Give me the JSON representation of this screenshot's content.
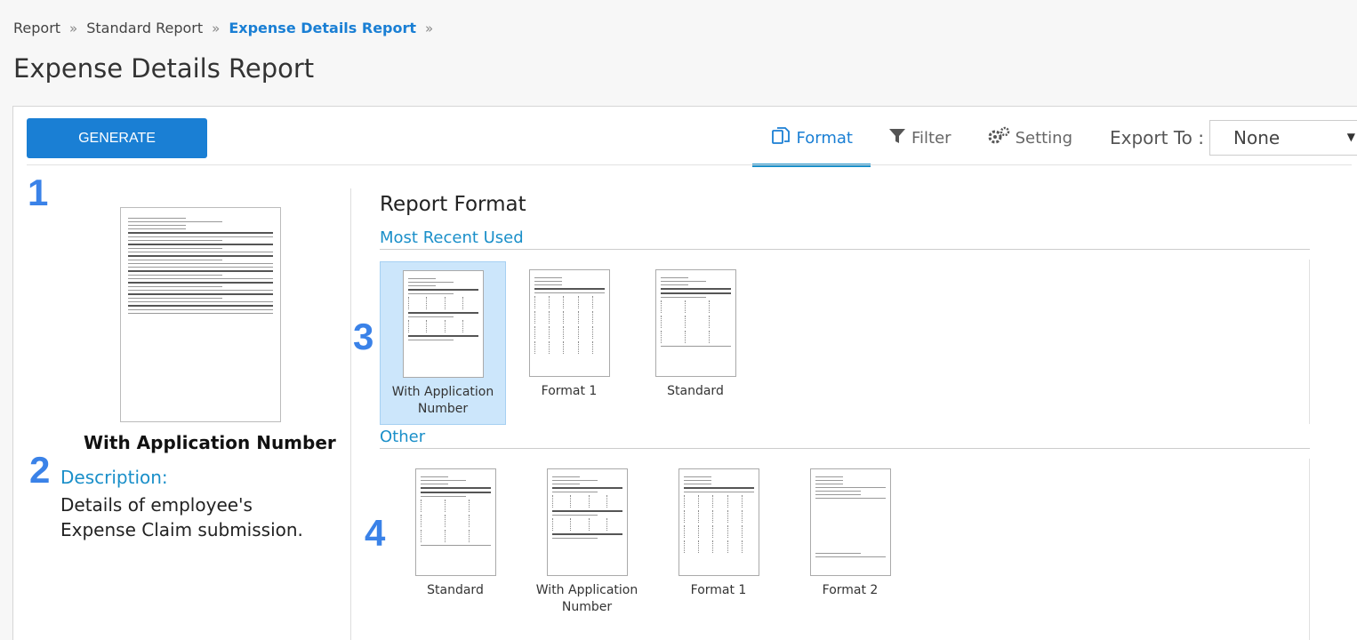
{
  "breadcrumb": [
    "Report",
    "Standard Report",
    "Expense Details Report"
  ],
  "page_title": "Expense Details Report",
  "toolbar": {
    "generate_label": "GENERATE",
    "tabs": [
      {
        "label": "Format",
        "icon": "format-icon",
        "active": true
      },
      {
        "label": "Filter",
        "icon": "filter-icon",
        "active": false
      },
      {
        "label": "Setting",
        "icon": "gears-icon",
        "active": false
      }
    ],
    "export_label": "Export To :",
    "export_value": "None"
  },
  "steps": [
    "1",
    "2",
    "3",
    "4"
  ],
  "preview": {
    "title": "With Application Number",
    "description_label": "Description:",
    "description": "Details of employee's Expense Claim submission."
  },
  "report_format": {
    "title": "Report Format",
    "most_recent_label": "Most Recent Used",
    "most_recent": [
      "With Application Number",
      "Format 1",
      "Standard"
    ],
    "other_label": "Other",
    "other": [
      "Standard",
      "With Application Number",
      "Format 1",
      "Format 2"
    ]
  },
  "colors": {
    "accent": "#1a7fd4",
    "tab_underline": "#1a8fc9",
    "selected_bg": "#cce6fb",
    "step_number": "#3a82e8"
  }
}
